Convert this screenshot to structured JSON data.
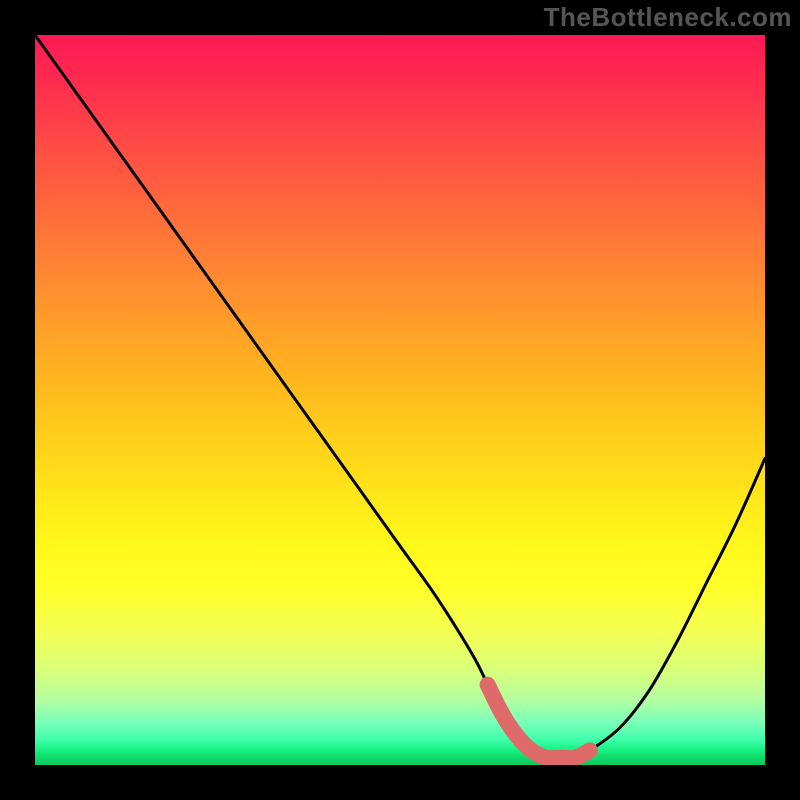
{
  "watermark": "TheBottleneck.com",
  "colors": {
    "frame": "#000000",
    "curve_stroke": "#000000",
    "highlight_stroke": "#de6a6a",
    "watermark_color": "#555555"
  },
  "chart_data": {
    "type": "line",
    "title": "",
    "xlabel": "",
    "ylabel": "",
    "xlim": [
      0,
      100
    ],
    "ylim": [
      0,
      100
    ],
    "grid": false,
    "legend": false,
    "series": [
      {
        "name": "bottleneck-curve",
        "x": [
          0,
          5,
          10,
          15,
          20,
          25,
          30,
          35,
          40,
          45,
          50,
          55,
          60,
          62,
          64,
          66,
          68,
          70,
          72,
          74,
          76,
          80,
          84,
          88,
          92,
          96,
          100
        ],
        "values": [
          100,
          93,
          86,
          79,
          72,
          65,
          58,
          51,
          44,
          37,
          30,
          23,
          15,
          11,
          7,
          4,
          2,
          1,
          1,
          1,
          2,
          5,
          10,
          17,
          25,
          33,
          42
        ]
      }
    ],
    "highlight_segment": {
      "series": "bottleneck-curve",
      "x_start": 62,
      "x_end": 76,
      "note": "flat minimum region drawn with thick salmon stroke"
    },
    "background_gradient": {
      "orientation": "vertical",
      "stops": [
        {
          "pos": 0.0,
          "color": "#ff1a55"
        },
        {
          "pos": 0.35,
          "color": "#ff8f30"
        },
        {
          "pos": 0.7,
          "color": "#fff81a"
        },
        {
          "pos": 0.92,
          "color": "#7dffb8"
        },
        {
          "pos": 1.0,
          "color": "#0acb5e"
        }
      ]
    }
  }
}
